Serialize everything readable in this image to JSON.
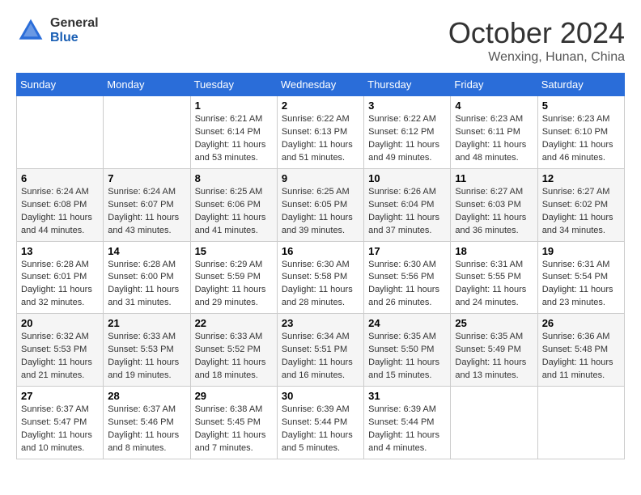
{
  "header": {
    "logo_general": "General",
    "logo_blue": "Blue",
    "month": "October 2024",
    "location": "Wenxing, Hunan, China"
  },
  "weekdays": [
    "Sunday",
    "Monday",
    "Tuesday",
    "Wednesday",
    "Thursday",
    "Friday",
    "Saturday"
  ],
  "weeks": [
    [
      {
        "day": "",
        "info": ""
      },
      {
        "day": "",
        "info": ""
      },
      {
        "day": "1",
        "info": "Sunrise: 6:21 AM\nSunset: 6:14 PM\nDaylight: 11 hours and 53 minutes."
      },
      {
        "day": "2",
        "info": "Sunrise: 6:22 AM\nSunset: 6:13 PM\nDaylight: 11 hours and 51 minutes."
      },
      {
        "day": "3",
        "info": "Sunrise: 6:22 AM\nSunset: 6:12 PM\nDaylight: 11 hours and 49 minutes."
      },
      {
        "day": "4",
        "info": "Sunrise: 6:23 AM\nSunset: 6:11 PM\nDaylight: 11 hours and 48 minutes."
      },
      {
        "day": "5",
        "info": "Sunrise: 6:23 AM\nSunset: 6:10 PM\nDaylight: 11 hours and 46 minutes."
      }
    ],
    [
      {
        "day": "6",
        "info": "Sunrise: 6:24 AM\nSunset: 6:08 PM\nDaylight: 11 hours and 44 minutes."
      },
      {
        "day": "7",
        "info": "Sunrise: 6:24 AM\nSunset: 6:07 PM\nDaylight: 11 hours and 43 minutes."
      },
      {
        "day": "8",
        "info": "Sunrise: 6:25 AM\nSunset: 6:06 PM\nDaylight: 11 hours and 41 minutes."
      },
      {
        "day": "9",
        "info": "Sunrise: 6:25 AM\nSunset: 6:05 PM\nDaylight: 11 hours and 39 minutes."
      },
      {
        "day": "10",
        "info": "Sunrise: 6:26 AM\nSunset: 6:04 PM\nDaylight: 11 hours and 37 minutes."
      },
      {
        "day": "11",
        "info": "Sunrise: 6:27 AM\nSunset: 6:03 PM\nDaylight: 11 hours and 36 minutes."
      },
      {
        "day": "12",
        "info": "Sunrise: 6:27 AM\nSunset: 6:02 PM\nDaylight: 11 hours and 34 minutes."
      }
    ],
    [
      {
        "day": "13",
        "info": "Sunrise: 6:28 AM\nSunset: 6:01 PM\nDaylight: 11 hours and 32 minutes."
      },
      {
        "day": "14",
        "info": "Sunrise: 6:28 AM\nSunset: 6:00 PM\nDaylight: 11 hours and 31 minutes."
      },
      {
        "day": "15",
        "info": "Sunrise: 6:29 AM\nSunset: 5:59 PM\nDaylight: 11 hours and 29 minutes."
      },
      {
        "day": "16",
        "info": "Sunrise: 6:30 AM\nSunset: 5:58 PM\nDaylight: 11 hours and 28 minutes."
      },
      {
        "day": "17",
        "info": "Sunrise: 6:30 AM\nSunset: 5:56 PM\nDaylight: 11 hours and 26 minutes."
      },
      {
        "day": "18",
        "info": "Sunrise: 6:31 AM\nSunset: 5:55 PM\nDaylight: 11 hours and 24 minutes."
      },
      {
        "day": "19",
        "info": "Sunrise: 6:31 AM\nSunset: 5:54 PM\nDaylight: 11 hours and 23 minutes."
      }
    ],
    [
      {
        "day": "20",
        "info": "Sunrise: 6:32 AM\nSunset: 5:53 PM\nDaylight: 11 hours and 21 minutes."
      },
      {
        "day": "21",
        "info": "Sunrise: 6:33 AM\nSunset: 5:53 PM\nDaylight: 11 hours and 19 minutes."
      },
      {
        "day": "22",
        "info": "Sunrise: 6:33 AM\nSunset: 5:52 PM\nDaylight: 11 hours and 18 minutes."
      },
      {
        "day": "23",
        "info": "Sunrise: 6:34 AM\nSunset: 5:51 PM\nDaylight: 11 hours and 16 minutes."
      },
      {
        "day": "24",
        "info": "Sunrise: 6:35 AM\nSunset: 5:50 PM\nDaylight: 11 hours and 15 minutes."
      },
      {
        "day": "25",
        "info": "Sunrise: 6:35 AM\nSunset: 5:49 PM\nDaylight: 11 hours and 13 minutes."
      },
      {
        "day": "26",
        "info": "Sunrise: 6:36 AM\nSunset: 5:48 PM\nDaylight: 11 hours and 11 minutes."
      }
    ],
    [
      {
        "day": "27",
        "info": "Sunrise: 6:37 AM\nSunset: 5:47 PM\nDaylight: 11 hours and 10 minutes."
      },
      {
        "day": "28",
        "info": "Sunrise: 6:37 AM\nSunset: 5:46 PM\nDaylight: 11 hours and 8 minutes."
      },
      {
        "day": "29",
        "info": "Sunrise: 6:38 AM\nSunset: 5:45 PM\nDaylight: 11 hours and 7 minutes."
      },
      {
        "day": "30",
        "info": "Sunrise: 6:39 AM\nSunset: 5:44 PM\nDaylight: 11 hours and 5 minutes."
      },
      {
        "day": "31",
        "info": "Sunrise: 6:39 AM\nSunset: 5:44 PM\nDaylight: 11 hours and 4 minutes."
      },
      {
        "day": "",
        "info": ""
      },
      {
        "day": "",
        "info": ""
      }
    ]
  ]
}
